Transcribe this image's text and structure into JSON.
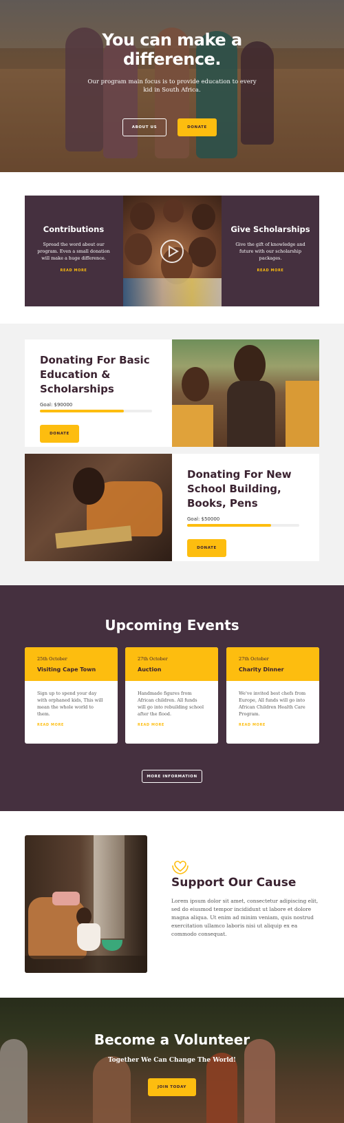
{
  "hero": {
    "title": "You can make a difference.",
    "subtitle": "Our program main focus is to provide education to every kid in South Africa.",
    "about_label": "ABOUT US",
    "donate_label": "DONATE"
  },
  "promo": {
    "left": {
      "title": "Contributions",
      "text": "Spread the word about our program. Even a small donation will make a huge difference.",
      "link": "READ MORE"
    },
    "right": {
      "title": "Give Scholarships",
      "text": "Give the gift of knowledge and future with our scholarship packages.",
      "link": "READ MORE"
    },
    "video_icon": "play-icon"
  },
  "donations": [
    {
      "title": "Donating For Basic Education & Scholarships",
      "goal": "Goal: $90000",
      "progress": 0.75,
      "button": "DONATE"
    },
    {
      "title": "Donating For New School Building, Books, Pens",
      "goal": "Goal: $50000",
      "progress": 0.75,
      "button": "DONATE"
    }
  ],
  "events": {
    "title": "Upcoming Events",
    "items": [
      {
        "date": "25th October",
        "title": "Visiting Cape Town",
        "desc": "Sign up to spend your day with orphaned kids, This will mean the whole world to them.",
        "link": "READ MORE"
      },
      {
        "date": "27th October",
        "title": "Auction",
        "desc": "Handmade figures from African children. All funds will go into rebuilding school after the flood.",
        "link": "READ MORE"
      },
      {
        "date": "27th October",
        "title": "Charity Dinner",
        "desc": "We've invited best chefs from Europe, All funds will go into African Children Health Care Program.",
        "link": "READ MORE"
      }
    ],
    "more_label": "MORE INFORMATION"
  },
  "support": {
    "icon": "heart-hands-icon",
    "title": "Support Our Cause",
    "text": "Lorem ipsum dolor sit amet, consectetur adipiscing elit, sed do eiusmod tempor incididunt ut labore et dolore magna aliqua. Ut enim ad minim veniam, quis nostrud exercitation ullamco laboris nisi ut aliquip ex ea commodo consequat."
  },
  "volunteer": {
    "title": "Become a Volunteer",
    "tagline": "Together We Can Change The World!",
    "button": "JOIN TODAY"
  },
  "colors": {
    "accent": "#fdbd0f",
    "plum": "#45303f"
  }
}
